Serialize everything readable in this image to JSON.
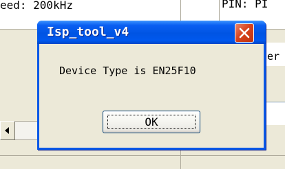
{
  "background": {
    "speed_label": "eed: 200kHz",
    "pin_label": "PIN: PI",
    "right_fragment": "er"
  },
  "dialog": {
    "title": "Isp_tool_v4",
    "message": "Device Type is EN25F10",
    "ok_label": "OK"
  },
  "colors": {
    "titlebar": "#0054e3",
    "close_button": "#d8431e",
    "face": "#ece9d8"
  },
  "icons": {
    "close": "close-icon",
    "scroll_left": "scroll-left-arrow-icon"
  }
}
